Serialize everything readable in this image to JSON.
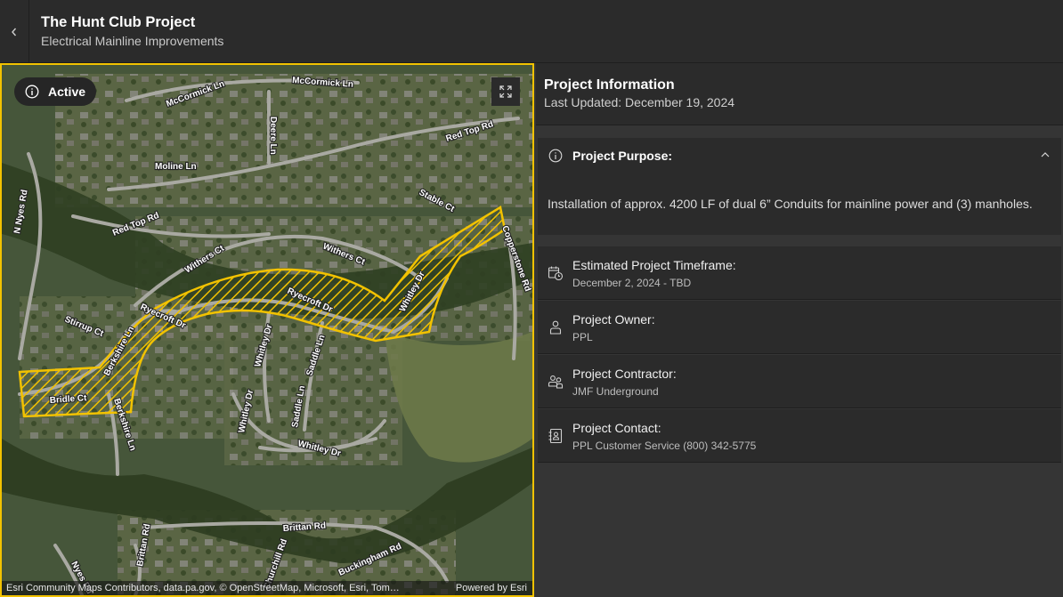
{
  "header": {
    "title": "The Hunt Club Project",
    "subtitle": "Electrical Mainline Improvements",
    "back_icon": "chevron-left-icon"
  },
  "map": {
    "status_label": "Active",
    "status_icon": "info-icon",
    "expand_icon": "expand-icon",
    "attribution": "Esri Community Maps Contributors, data.pa.gov, © OpenStreetMap, Microsoft, Esri, Tom…",
    "powered_by": "Powered by Esri",
    "highlight_color": "#f2c200",
    "street_labels": {
      "mccormick_1": "McCormick Ln",
      "mccormick_2": "McCormick Ln",
      "deere": "Deere Ln",
      "red_top_1": "Red Top Rd",
      "red_top_2": "Red Top Rd",
      "moline": "Moline Ln",
      "n_nyes": "N Nyes Rd",
      "stable": "Stable Ct",
      "coppertone": "Copperstone Rd",
      "withers_1": "Withers Ct",
      "withers_2": "Withers Ct",
      "whitley_1": "Whitley Dr",
      "ryecroft_1": "Ryecroft Dr",
      "ryecroft_2": "Ryecroft Dr",
      "stirrup": "Stirrup Ct",
      "berkshire_1": "Berkshire Ln",
      "berkshire_2": "Berkshire Ln",
      "whitley_2": "Whitley Dr",
      "saddle_1": "Saddle Ln",
      "saddle_2": "Saddle Ln",
      "whitley_3": "Whitley Dr",
      "whitley_4": "Whitley Dr",
      "bridle": "Bridle Ct",
      "brittan_1": "Brittan Rd",
      "brittan_2": "Brittan Rd",
      "buckingham": "Buckingham Rd",
      "churchill": "Churchill Rd",
      "nyes": "Nyes Rd"
    }
  },
  "panel": {
    "title": "Project Information",
    "updated": "Last Updated: December 19, 2024",
    "purpose": {
      "label": "Project Purpose:",
      "icon": "info-icon",
      "chevron_icon": "chevron-up-icon",
      "text": "Installation of approx. 4200 LF of dual 6” Conduits for mainline power and  (3) manholes."
    },
    "details": [
      {
        "label": "Estimated Project Timeframe:",
        "value": "December 2, 2024 - TBD",
        "icon": "calendar-clock-icon"
      },
      {
        "label": "Project Owner:",
        "value": "PPL",
        "icon": "person-icon"
      },
      {
        "label": "Project Contractor:",
        "value": "JMF Underground",
        "icon": "people-icon"
      },
      {
        "label": "Project Contact:",
        "value": "PPL Customer Service (800) 342-5775",
        "icon": "contact-book-icon"
      }
    ]
  }
}
